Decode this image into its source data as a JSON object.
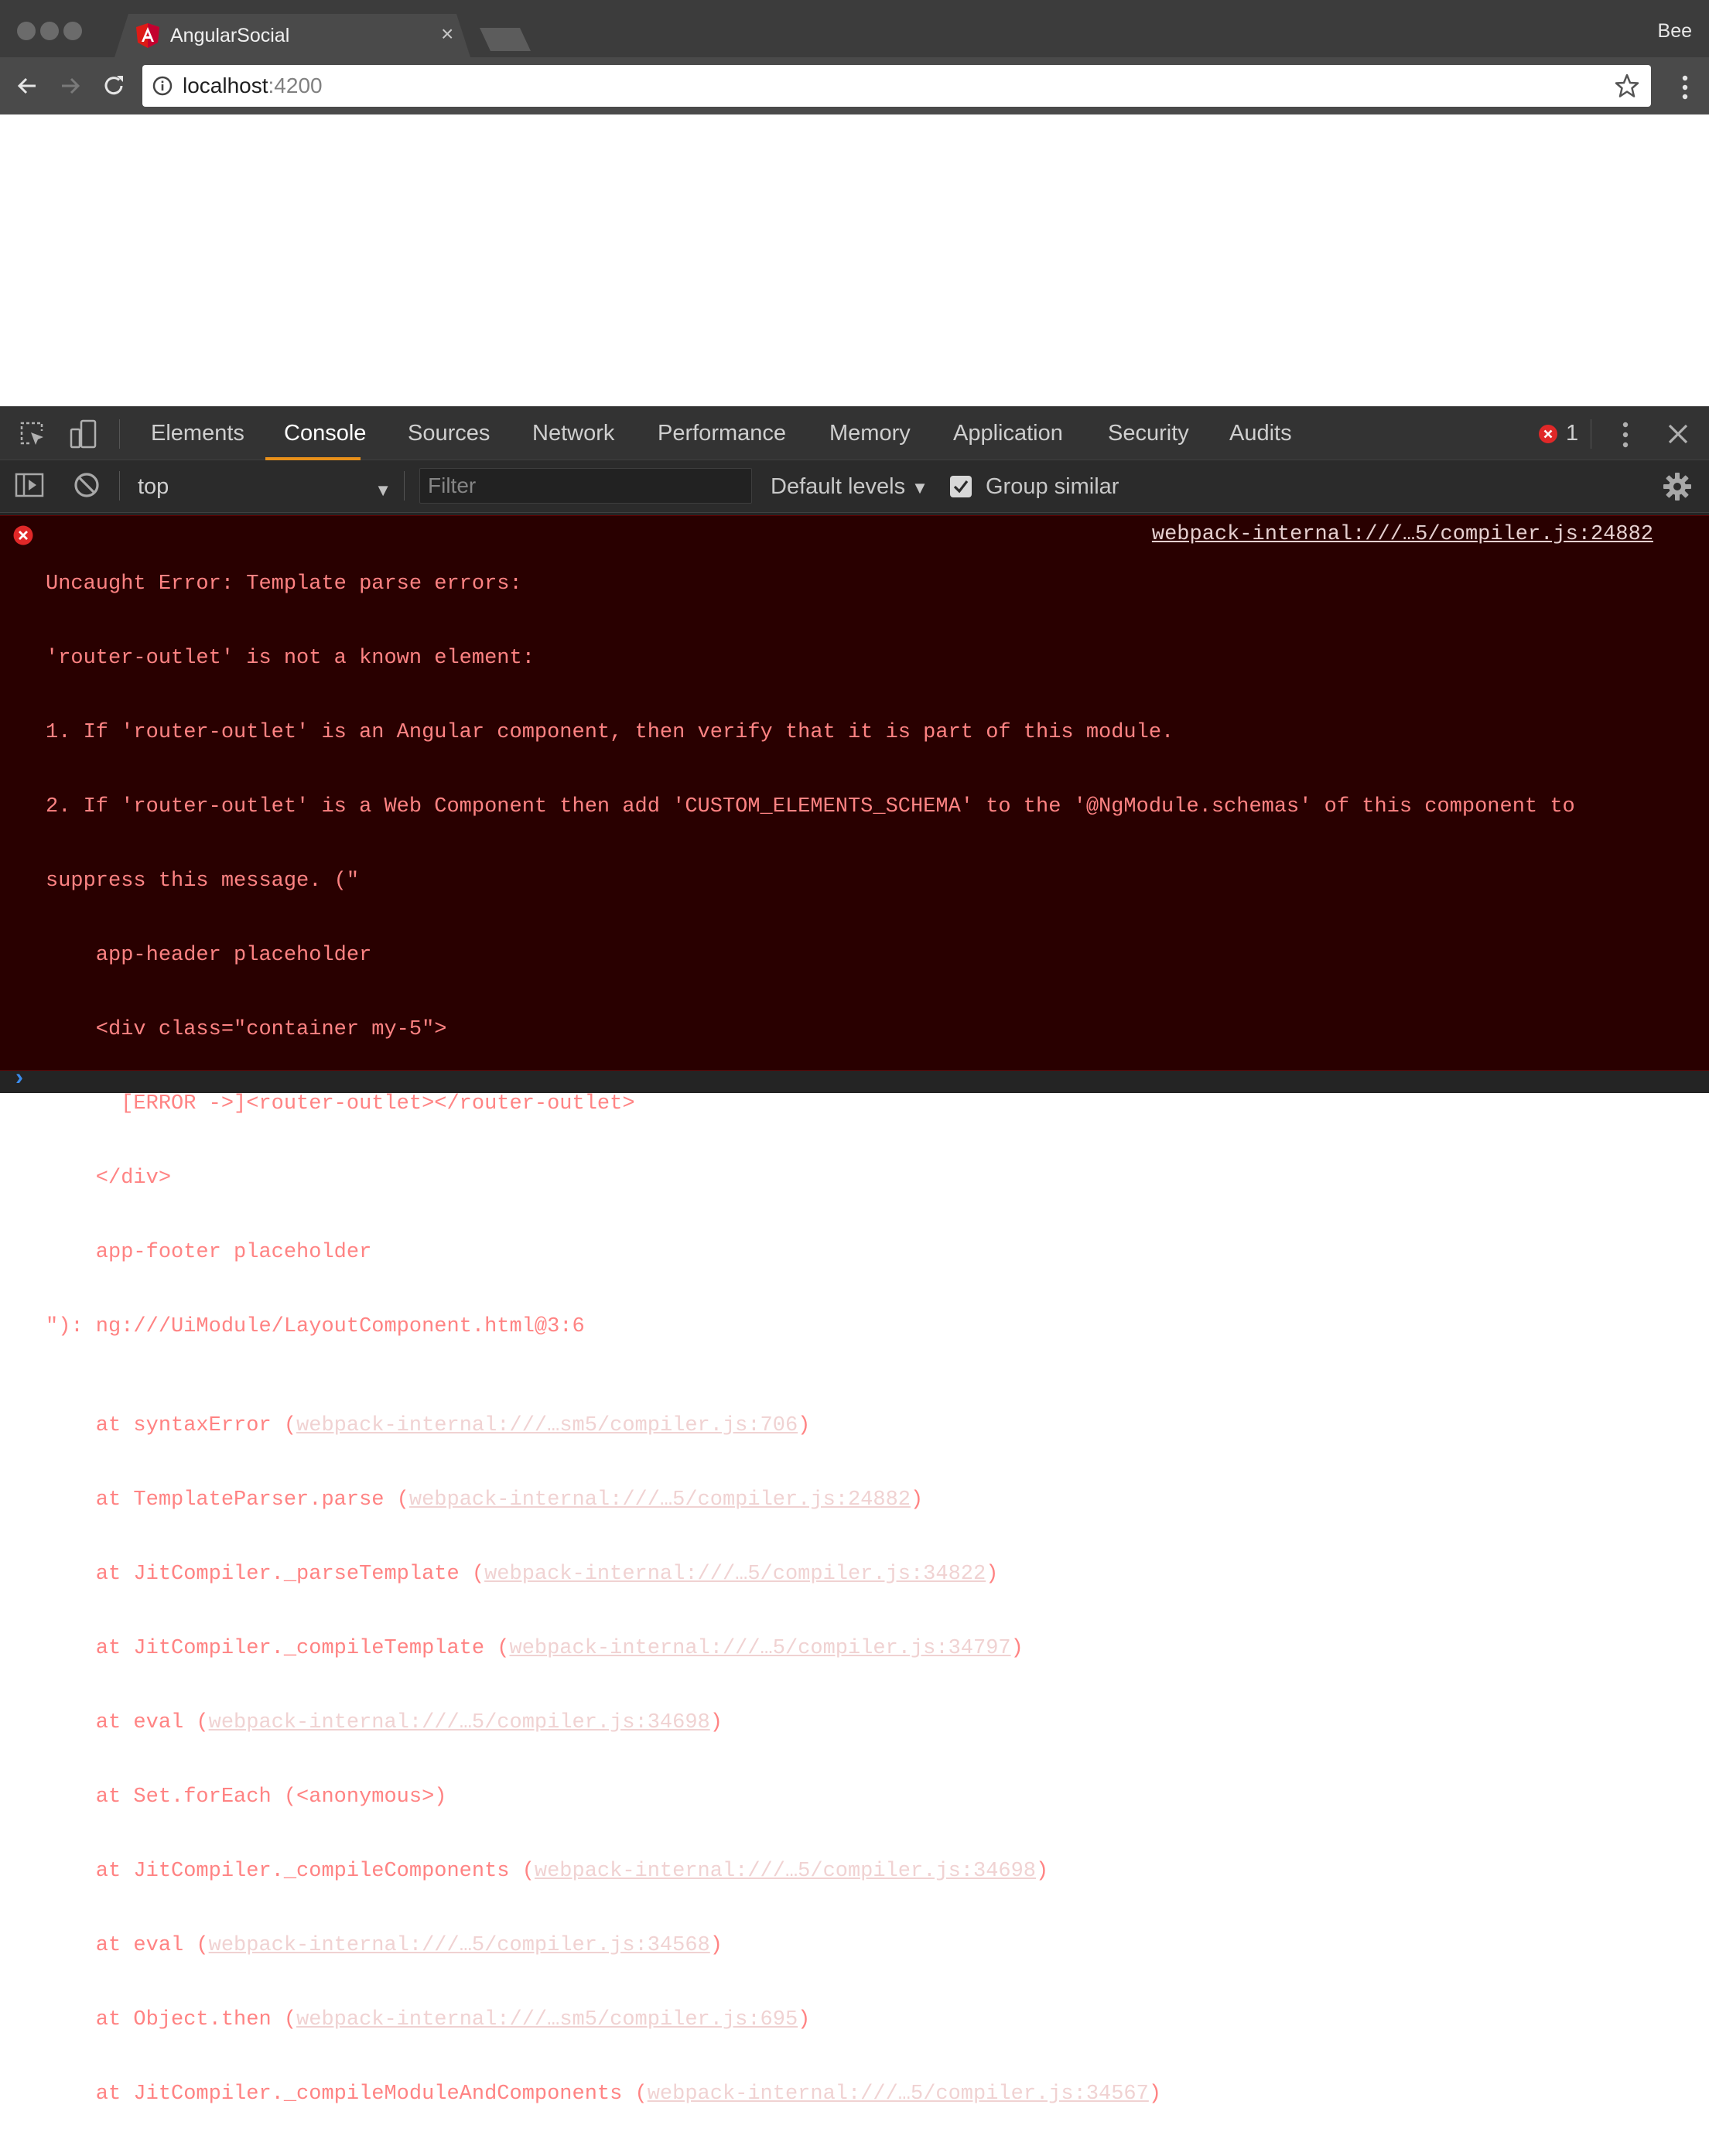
{
  "browser": {
    "tab_title": "AngularSocial",
    "tab_close": "×",
    "profile_name": "Bee",
    "url_host": "localhost",
    "url_port": ":4200"
  },
  "devtools": {
    "tabs": [
      "Elements",
      "Console",
      "Sources",
      "Network",
      "Performance",
      "Memory",
      "Application",
      "Security",
      "Audits"
    ],
    "active_tab": "Console",
    "error_count": "1",
    "context": "top",
    "filter_placeholder": "Filter",
    "levels_label": "Default levels",
    "group_similar_label": "Group similar",
    "group_similar_checked": true
  },
  "console": {
    "source_link": "webpack-internal:///…5/compiler.js:24882",
    "message_lines": [
      "Uncaught Error: Template parse errors:",
      "'router-outlet' is not a known element:",
      "1. If 'router-outlet' is an Angular component, then verify that it is part of this module.",
      "2. If 'router-outlet' is a Web Component then add 'CUSTOM_ELEMENTS_SCHEMA' to the '@NgModule.schemas' of this component to",
      "suppress this message. (\"",
      "    app-header placeholder",
      "    <div class=\"container my-5\">",
      "      [ERROR ->]<router-outlet></router-outlet>",
      "    </div>",
      "    app-footer placeholder",
      "\"): ng:///UiModule/LayoutComponent.html@3:6"
    ],
    "stack": [
      {
        "pre": "    at syntaxError (",
        "link": "webpack-internal:///…sm5/compiler.js:706",
        "post": ")"
      },
      {
        "pre": "    at TemplateParser.parse (",
        "link": "webpack-internal:///…5/compiler.js:24882",
        "post": ")"
      },
      {
        "pre": "    at JitCompiler._parseTemplate (",
        "link": "webpack-internal:///…5/compiler.js:34822",
        "post": ")"
      },
      {
        "pre": "    at JitCompiler._compileTemplate (",
        "link": "webpack-internal:///…5/compiler.js:34797",
        "post": ")"
      },
      {
        "pre": "    at eval (",
        "link": "webpack-internal:///…5/compiler.js:34698",
        "post": ")"
      },
      {
        "pre": "    at Set.forEach (<anonymous>)",
        "link": "",
        "post": ""
      },
      {
        "pre": "    at JitCompiler._compileComponents (",
        "link": "webpack-internal:///…5/compiler.js:34698",
        "post": ")"
      },
      {
        "pre": "    at eval (",
        "link": "webpack-internal:///…5/compiler.js:34568",
        "post": ")"
      },
      {
        "pre": "    at Object.then (",
        "link": "webpack-internal:///…sm5/compiler.js:695",
        "post": ")"
      },
      {
        "pre": "    at JitCompiler._compileModuleAndComponents (",
        "link": "webpack-internal:///…5/compiler.js:34567",
        "post": ")"
      }
    ],
    "prompt_symbol": "›"
  },
  "icons": [
    "angular-logo-icon",
    "back-arrow-icon",
    "forward-arrow-icon",
    "reload-icon",
    "info-icon",
    "star-icon",
    "more-vert-icon",
    "inspect-element-icon",
    "device-toolbar-icon",
    "error-icon",
    "close-icon",
    "sidebar-toggle-icon",
    "clear-console-icon",
    "gear-icon"
  ],
  "colors": {
    "error_text": "#ff8383",
    "error_background": "#290000",
    "active_tab_underline": "#e8901a",
    "error_badge": "#e02828",
    "angular_red": "#dd1b16"
  }
}
